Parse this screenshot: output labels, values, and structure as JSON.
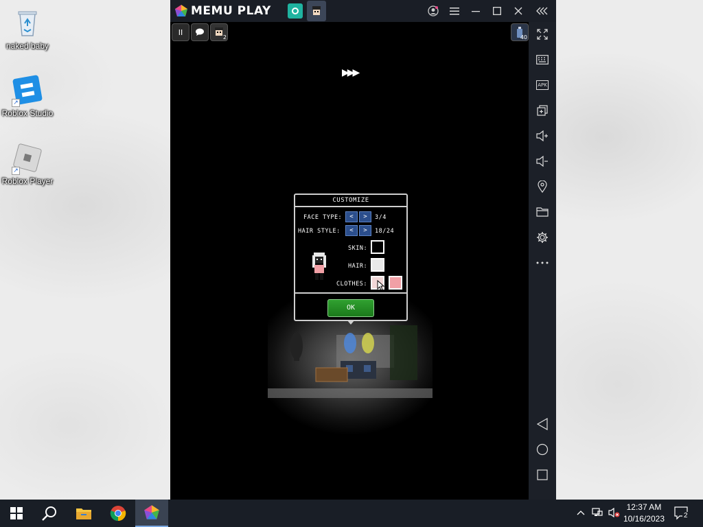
{
  "desktop": {
    "icons": [
      {
        "label": "naked baby",
        "icon": "recycle-bin-icon"
      },
      {
        "label": "Roblox Studio",
        "icon": "roblox-studio-icon"
      },
      {
        "label": "Roblox Player",
        "icon": "roblox-player-icon"
      }
    ]
  },
  "emulator": {
    "app_name": "MEMU PLAY",
    "badge_count": "40",
    "sidebar_icons": [
      "fullscreen-icon",
      "keyboard-icon",
      "apk-icon",
      "multi-instance-icon",
      "volume-up-icon",
      "volume-down-icon",
      "location-icon",
      "folder-icon",
      "settings-icon",
      "more-icon",
      "back-icon",
      "home-icon",
      "recent-apps-icon"
    ],
    "apk_label": "APK",
    "title_buttons": [
      "account-icon",
      "menu-icon",
      "minimize-icon",
      "maximize-icon",
      "close-icon",
      "collapse-icon"
    ],
    "top_buttons": {
      "pause": "II",
      "player_badge": "2"
    }
  },
  "game": {
    "skip_glyph": "▶▶▶",
    "dialog": {
      "title": "CUSTOMIZE",
      "face_type_label": "FACE TYPE:",
      "face_type_value": "3/4",
      "hair_style_label": "HAIR STYLE:",
      "hair_style_value": "18/24",
      "skin_label": "SKIN:",
      "hair_label": "HAIR:",
      "clothes_label": "CLOTHES:",
      "prev_glyph": "<",
      "next_glyph": ">",
      "ok_label": "OK",
      "colors": {
        "skin": "#000000",
        "hair": "#e8e8e8",
        "clothes_primary": "#f1d7d7",
        "clothes_secondary": "#f1a0a6"
      }
    }
  },
  "taskbar": {
    "apps": [
      "windows-start-icon",
      "search-icon",
      "file-explorer-icon",
      "chrome-icon",
      "memu-icon"
    ],
    "time": "12:37 AM",
    "date": "10/16/2023",
    "notification_count": "2"
  }
}
